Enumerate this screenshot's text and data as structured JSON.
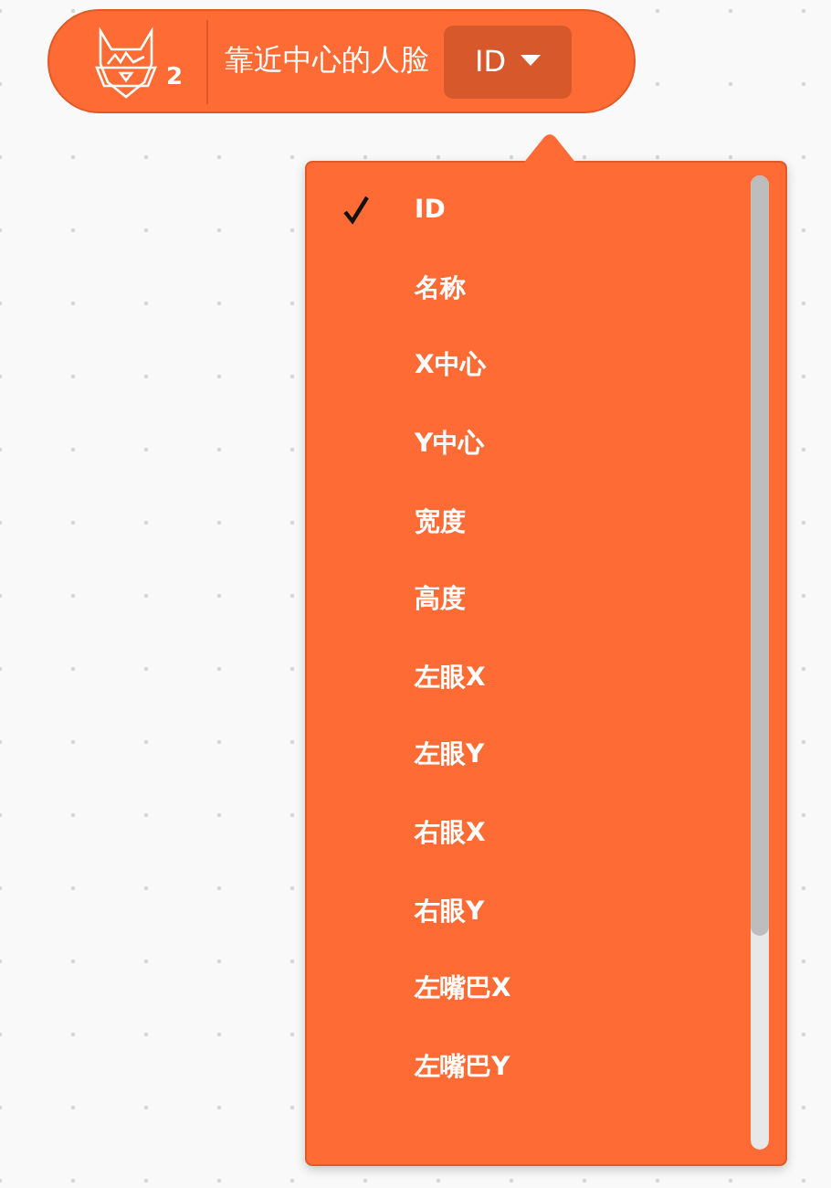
{
  "block": {
    "badge": "2",
    "label": "靠近中心的人脸",
    "dropdown": "ID"
  },
  "menu": {
    "items": [
      {
        "label": "ID",
        "selected": true
      },
      {
        "label": "名称",
        "selected": false
      },
      {
        "label": "X中心",
        "selected": false
      },
      {
        "label": "Y中心",
        "selected": false
      },
      {
        "label": "宽度",
        "selected": false
      },
      {
        "label": "高度",
        "selected": false
      },
      {
        "label": "左眼X",
        "selected": false
      },
      {
        "label": "左眼Y",
        "selected": false
      },
      {
        "label": "右眼X",
        "selected": false
      },
      {
        "label": "右眼Y",
        "selected": false
      },
      {
        "label": "左嘴巴X",
        "selected": false
      },
      {
        "label": "左嘴巴Y",
        "selected": false
      }
    ]
  }
}
